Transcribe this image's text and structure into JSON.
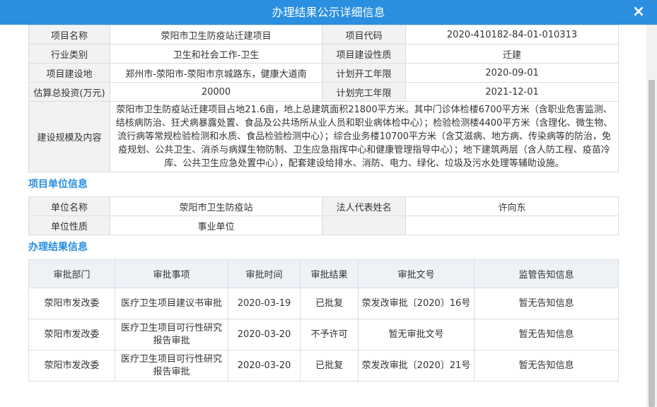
{
  "dialog": {
    "title": "办理结果公示详细信息",
    "close_icon": "×"
  },
  "project": {
    "rows": [
      [
        "项目名称",
        "荥阳市卫生防疫站迁建项目",
        "项目代码",
        "2020-410182-84-01-010313"
      ],
      [
        "行业类别",
        "卫生和社会工作-卫生",
        "项目建设性质",
        "迁建"
      ],
      [
        "项目建设地",
        "郑州市-荥阳市-荥阳市京城路东，健康大道南",
        "计划开工年限",
        "2020-09-01"
      ],
      [
        "估算总投资(万元)",
        "20000",
        "计划完工年限",
        "2021-12-01"
      ]
    ],
    "scale_label": "建设规模及内容",
    "scale_value": "荥阳市卫生防疫站迁建项目占地21.6亩，地上总建筑面积21800平方米。其中门诊体检楼6700平方米（含职业危害监测、结核病防治、狂犬病暴露处置、食品及公共场所从业人员和职业病体检中心）；检验检测楼4400平方米（含理化、微生物、流行病等常规检验检测和水质、食品检验检测中心）；综合业务楼10700平方米（含艾滋病、地方病、传染病等的防治，免疫规划、公共卫生、消杀与病媒生物防制、卫生应急指挥中心和健康管理指导中心）；地下建筑两层（含人防工程、疫苗冷库、公共卫生应急处置中心），配套建设给排水、消防、电力、绿化、垃圾及污水处理等辅助设施。"
  },
  "unit": {
    "section_title": "项目单位信息",
    "rows": [
      [
        "单位名称",
        "荥阳市卫生防疫站",
        "法人代表姓名",
        "许向东"
      ],
      [
        "单位性质",
        "事业单位",
        "",
        ""
      ]
    ]
  },
  "results": {
    "section_title": "办理结果信息",
    "headers": [
      "审批部门",
      "审批事项",
      "审批时间",
      "审批结果",
      "审批文号",
      "监管告知信息"
    ],
    "rows": [
      [
        "荥阳市发改委",
        "医疗卫生项目建议书审批",
        "2020-03-19",
        "已批复",
        "荥发改审批〔2020〕16号",
        "暂无告知信息"
      ],
      [
        "荥阳市发改委",
        "医疗卫生项目可行性研究报告审批",
        "2020-03-20",
        "不予许可",
        "暂无审批文号",
        "暂无告知信息"
      ],
      [
        "荥阳市发改委",
        "医疗卫生项目可行性研究报告审批",
        "2020-03-20",
        "已批复",
        "荥发改审批〔2020〕21号",
        "暂无告知信息"
      ]
    ]
  }
}
